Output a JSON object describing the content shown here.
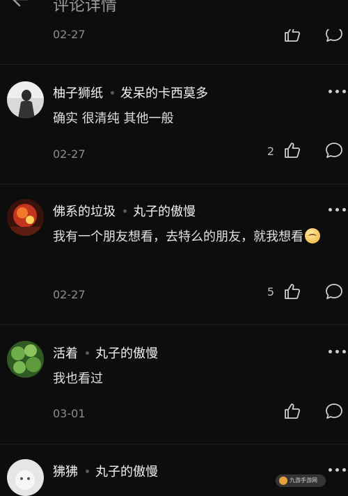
{
  "header": {
    "title": "评论详情"
  },
  "top_item": {
    "date": "02-27"
  },
  "comments": [
    {
      "author": "柚子狮纸",
      "reply_to": "发呆的卡西莫多",
      "text": "确实 很清纯 其他一般",
      "date": "02-27",
      "likes": "2"
    },
    {
      "author": "佛系的垃圾",
      "reply_to": "丸子的傲慢",
      "text": "我有一个朋友想看，去特么的朋友，就我想看",
      "date": "02-27",
      "likes": "5"
    },
    {
      "author": "活着",
      "reply_to": "丸子的傲慢",
      "text": "我也看过",
      "date": "03-01",
      "likes": ""
    },
    {
      "author": "狒狒",
      "reply_to": "丸子的傲慢"
    }
  ],
  "watermark": {
    "text": "九游手游网"
  },
  "icons": {
    "back": "arrow-left-icon",
    "like": "thumbs-up-icon",
    "comment": "comment-bubble-icon",
    "more": "more-dots-icon",
    "emoji": "smiling-face-icon"
  },
  "colors": {
    "background": "#0d0d0d",
    "text": "#e6e6e6",
    "meta": "#8c8c8c"
  }
}
